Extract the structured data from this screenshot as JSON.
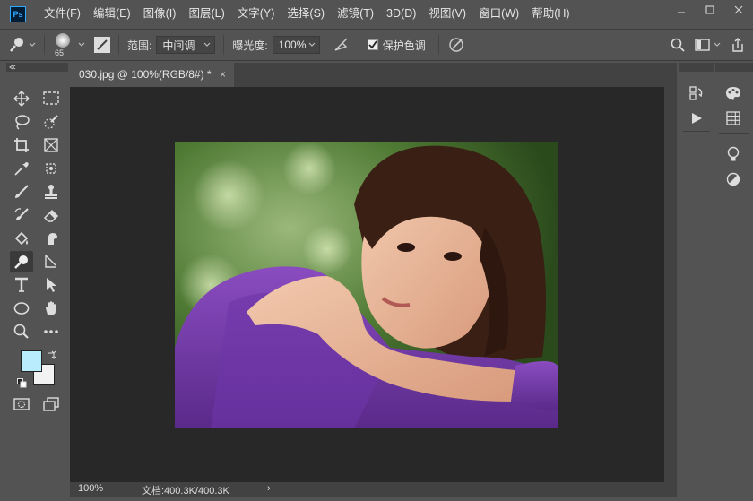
{
  "app": {
    "logo": "Ps"
  },
  "menu": [
    "文件(F)",
    "编辑(E)",
    "图像(I)",
    "图层(L)",
    "文字(Y)",
    "选择(S)",
    "滤镜(T)",
    "3D(D)",
    "视图(V)",
    "窗口(W)",
    "帮助(H)"
  ],
  "options": {
    "brush_size": "65",
    "range_label": "范围:",
    "range_value": "中间调",
    "exposure_label": "曝光度:",
    "exposure_value": "100%",
    "protect_tones_label": "保护色调",
    "protect_tones_checked": true
  },
  "document": {
    "tab_title": "030.jpg @ 100%(RGB/8#) *",
    "close_glyph": "×"
  },
  "status": {
    "zoom": "100%",
    "doc_info": "文档:400.3K/400.3K",
    "arrow": "›"
  },
  "colors": {
    "foreground": "#b9ecfc",
    "background": "#f2f2f2"
  },
  "tools": [
    "move-tool",
    "marquee-tool",
    "lasso-tool",
    "quick-selection-tool",
    "crop-tool",
    "frame-tool",
    "eyedropper-tool",
    "spot-healing-tool",
    "brush-tool",
    "clone-stamp-tool",
    "history-brush-tool",
    "eraser-tool",
    "paint-bucket-tool",
    "smudge-tool",
    "dodge-tool",
    "pen-tool",
    "type-tool",
    "path-selection-tool",
    "ellipse-tool",
    "hand-tool",
    "zoom-tool",
    "more-tools"
  ]
}
